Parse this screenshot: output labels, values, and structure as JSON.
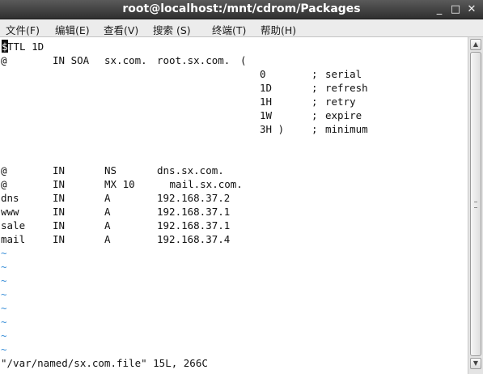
{
  "window": {
    "title": "root@localhost:/mnt/cdrom/Packages",
    "minimize_glyph": "_",
    "maximize_glyph": "□",
    "close_glyph": "✕"
  },
  "menu": [
    {
      "label": "文件(F)"
    },
    {
      "label": "编辑(E)"
    },
    {
      "label": "查看(V)"
    },
    {
      "label": "搜索 (S)"
    },
    {
      "label": "终端(T)"
    },
    {
      "label": "帮助(H)"
    }
  ],
  "editor": {
    "cursor_char": "$",
    "line1_rest": "TTL 1D",
    "soa": {
      "name": "@",
      "class": "IN SOA",
      "primary": "sx.com.",
      "admin": "root.sx.com.",
      "paren": "("
    },
    "soa_params": [
      {
        "value": "0",
        "sep": ";",
        "label": "serial"
      },
      {
        "value": "1D",
        "sep": ";",
        "label": "refresh"
      },
      {
        "value": "1H",
        "sep": ";",
        "label": "retry"
      },
      {
        "value": "1W",
        "sep": ";",
        "label": "expire"
      },
      {
        "value": "3H )",
        "sep": ";",
        "label": "minimum"
      }
    ],
    "records": [
      {
        "name": "@",
        "class": "IN",
        "type": "NS",
        "data": "dns.sx.com."
      },
      {
        "name": "@",
        "class": "IN",
        "type": "MX 10",
        "data": " mail.sx.com."
      },
      {
        "name": "dns",
        "class": "IN",
        "type": "A",
        "data": "192.168.37.2"
      },
      {
        "name": "www",
        "class": "IN",
        "type": "A",
        "data": "192.168.37.1"
      },
      {
        "name": "sale",
        "class": "IN",
        "type": "A",
        "data": "192.168.37.1"
      },
      {
        "name": "mail",
        "class": "IN",
        "type": "A",
        "data": "192.168.37.4"
      }
    ],
    "tilde": "~",
    "status_line": "\"/var/named/sx.com.file\" 15L, 266C"
  }
}
